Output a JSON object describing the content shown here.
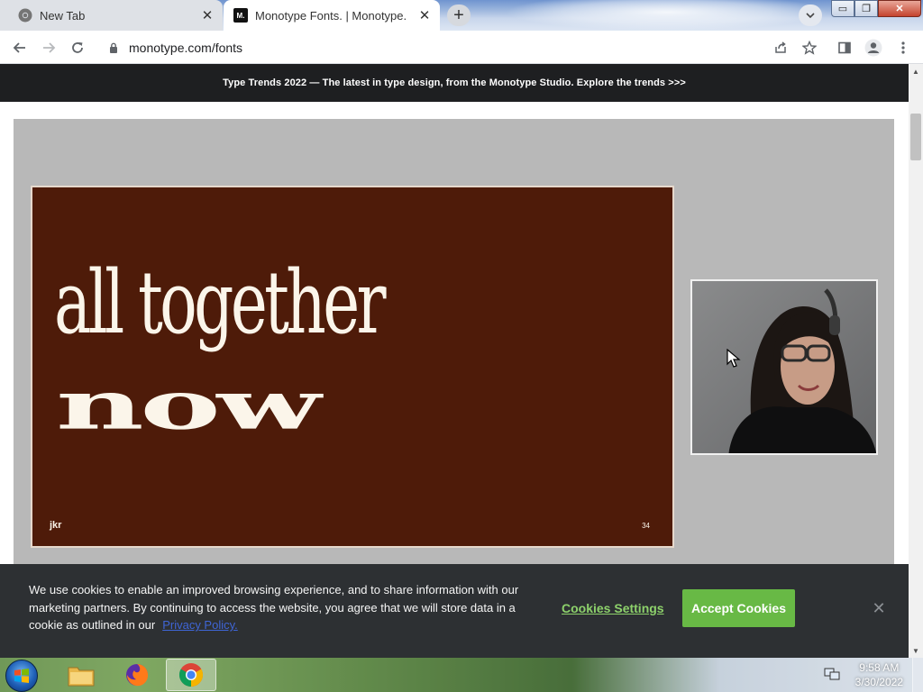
{
  "browser": {
    "tabs": [
      {
        "title": "New Tab",
        "icon": "chrome-icon",
        "active": false
      },
      {
        "title": "Monotype Fonts. | Monotype.",
        "favicon_text": "M.",
        "active": true
      }
    ],
    "url": "monotype.com/fonts"
  },
  "banner": {
    "text": "Type Trends 2022 — The latest in type design, from the Monotype Studio. Explore the trends >>>"
  },
  "slide": {
    "line1": "all together",
    "line2": "now",
    "brand": "jkr",
    "page_number": "34",
    "background_color": "#4e1b09",
    "text_color": "#fbf5ea"
  },
  "cookie_banner": {
    "message": "We use cookies to enable an improved browsing experience, and to share information with our marketing partners. By continuing to access the website, you agree that we will store data in a cookie as outlined in our",
    "link_text": "Privacy Policy.",
    "settings_label": "Cookies Settings",
    "accept_label": "Accept Cookies",
    "accent_color": "#68b945"
  },
  "taskbar": {
    "time": "9:58 AM",
    "date": "3/30/2022",
    "apps": [
      "windows-explorer",
      "firefox",
      "chrome"
    ]
  }
}
